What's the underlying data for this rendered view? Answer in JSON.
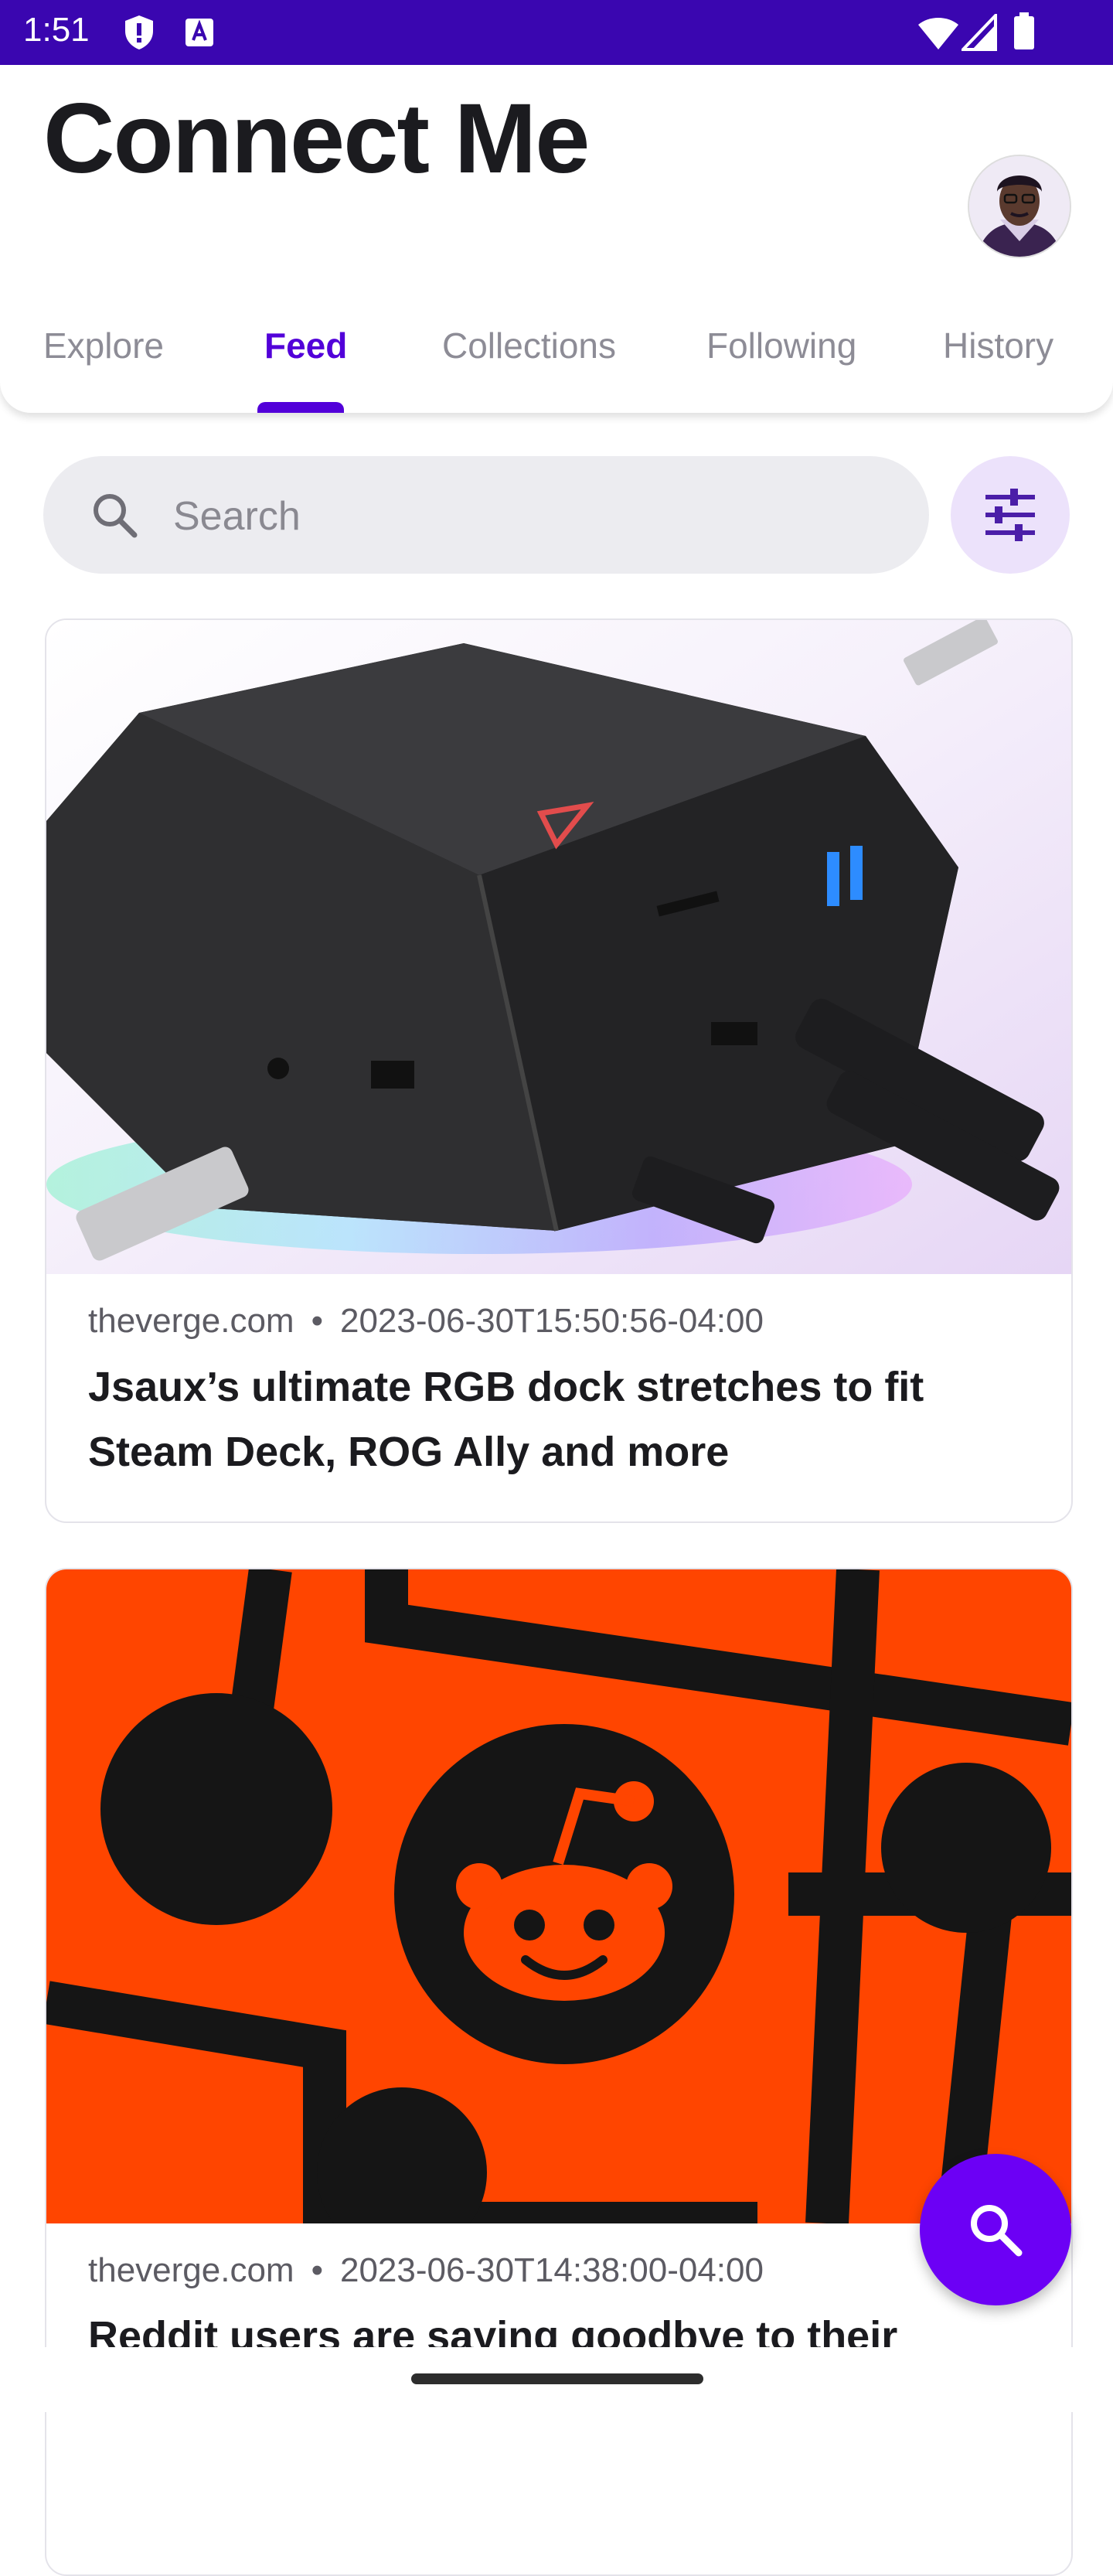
{
  "status_bar": {
    "time": "1:51",
    "icons": [
      "shield-icon",
      "a-icon",
      "wifi-icon",
      "signal-icon",
      "battery-icon"
    ]
  },
  "header": {
    "title": "Connect Me",
    "avatar": "profile-avatar"
  },
  "tabs": [
    {
      "label": "Explore",
      "active": false
    },
    {
      "label": "Feed",
      "active": true
    },
    {
      "label": "Collections",
      "active": false
    },
    {
      "label": "Following",
      "active": false
    },
    {
      "label": "History",
      "active": false
    }
  ],
  "search": {
    "placeholder": "Search"
  },
  "feed": [
    {
      "source": "theverge.com",
      "separator": "•",
      "timestamp": "2023-06-30T15:50:56-04:00",
      "headline": "Jsaux’s ultimate RGB dock stretches to fit Steam Deck, ROG Ally and more"
    },
    {
      "source": "theverge.com",
      "separator": "•",
      "timestamp": "2023-06-30T14:38:00-04:00",
      "headline": "Reddit users are saying goodbye to their"
    }
  ],
  "colors": {
    "status_bar": "#3a06b0",
    "accent": "#5200d9",
    "fab": "#6c00f5",
    "reddit_orange": "#ff4500"
  }
}
